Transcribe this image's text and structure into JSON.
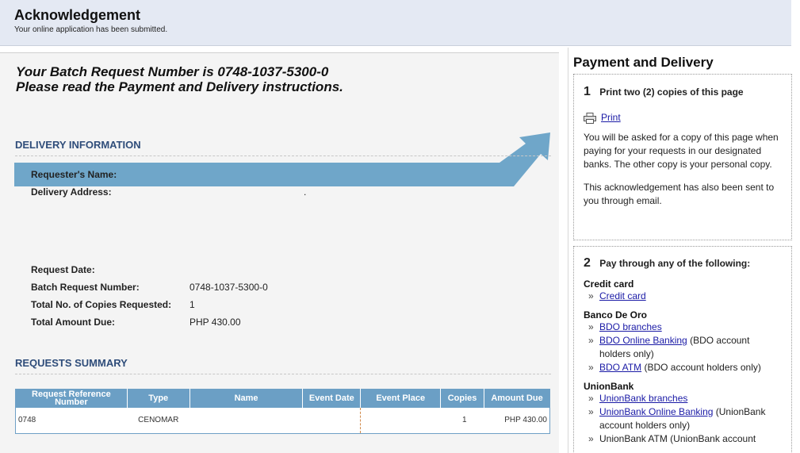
{
  "header": {
    "title": "Acknowledgement",
    "subtitle": "Your online application has been submitted."
  },
  "main": {
    "batch_line1": "Your Batch Request Number is 0748-1037-5300-0",
    "batch_line2": "Please read the Payment and Delivery instructions.",
    "delivery": {
      "title": "DELIVERY INFORMATION",
      "requester_label": "Requester's Name:",
      "address_label": "Delivery Address:",
      "address_value": ".",
      "request_date_label": "Request Date:",
      "batch_label": "Batch Request Number:",
      "batch_value": "0748-1037-5300-0",
      "copies_label": "Total No. of Copies Requested:",
      "copies_value": "1",
      "amount_label": "Total Amount Due:",
      "amount_value": "PHP 430.00"
    },
    "summary": {
      "title": "REQUESTS SUMMARY",
      "columns": [
        "Request Reference Number",
        "Type",
        "Name",
        "Event Date",
        "Event Place",
        "Copies",
        "Amount Due"
      ],
      "rows": [
        [
          "0748",
          "CENOMAR",
          "",
          "",
          "",
          "1",
          "PHP 430.00"
        ]
      ]
    }
  },
  "side": {
    "title": "Payment and Delivery",
    "step1": {
      "num": "1",
      "text": "Print two (2) copies of this page",
      "print_label": "Print",
      "para1": "You will be asked for a copy of this page when paying for your requests in our designated banks. The other copy is your personal copy.",
      "para2": "This acknowledgement has also been sent to you through email."
    },
    "step2": {
      "num": "2",
      "text": "Pay through any of the following:",
      "credit_head": "Credit card",
      "credit_link": "Credit card",
      "bdo_head": "Banco De Oro",
      "bdo_branches": "BDO branches",
      "bdo_online": "BDO Online Banking",
      "bdo_online_note": " (BDO account holders only)",
      "bdo_atm": "BDO ATM",
      "bdo_atm_note": " (BDO account holders only)",
      "ub_head": "UnionBank",
      "ub_branches": "UnionBank branches",
      "ub_online": "UnionBank Online Banking",
      "ub_online_note": " (UnionBank account holders only)",
      "ub_atm": "UnionBank ATM (UnionBank account"
    }
  },
  "colors": {
    "header_bg": "#e4e9f3",
    "arrow": "#6fa6c9",
    "section_title": "#2f4d7a",
    "table_header": "#6b9fc5",
    "link": "#1a1aa6"
  }
}
